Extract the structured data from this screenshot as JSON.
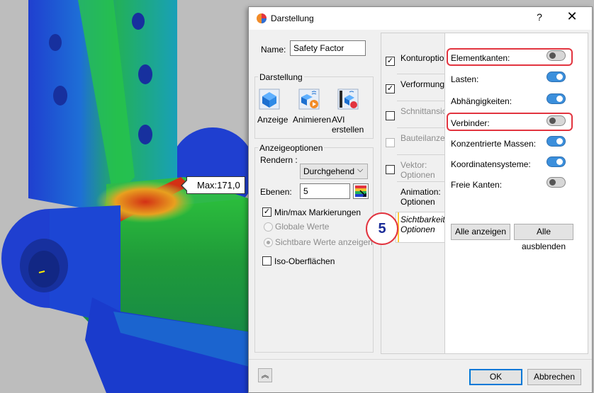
{
  "viewport": {
    "max_label": "Max:171,0",
    "colors": {
      "background": "#bdbdbd",
      "low": "#1f3fd0",
      "mid": "#22b05a",
      "high": "#d33015"
    }
  },
  "dialog": {
    "title": "Darstellung",
    "help_glyph": "?",
    "close_glyph": "✕",
    "name_label": "Name:",
    "name_value": "Safety Factor",
    "darstellung_group": "Darstellung",
    "actions": [
      {
        "label": "Anzeige",
        "icon": "cube-display-icon"
      },
      {
        "label": "Animieren",
        "icon": "animate-icon"
      },
      {
        "label": "AVI erstellen",
        "icon": "avi-record-icon"
      }
    ],
    "anzeige_group": "Anzeigeoptionen",
    "render_label": "Rendern :",
    "render_value": "Durchgehend",
    "levels_label": "Ebenen:",
    "levels_value": "5",
    "minmax_label": "Min/max Markierungen",
    "minmax_checked": true,
    "global_label": "Globale Werte",
    "visible_label": "Sichtbare Werte anzeigen",
    "iso_label": "Iso-Oberflächen",
    "iso_checked": false,
    "tabs": [
      {
        "label": "Konturoptionen",
        "checked": true
      },
      {
        "label": "Verformungsoptionen",
        "checked": true
      },
      {
        "label": "Schnittansicht",
        "checked": false
      },
      {
        "label": "Bauteilanzeige",
        "checked": false
      },
      {
        "label": "Vektor: Optionen",
        "checked": false
      },
      {
        "label": "Animation: Optionen"
      },
      {
        "label": "Sichtbarkeit: Optionen",
        "selected": true
      }
    ],
    "visibility": [
      {
        "label": "Elementkanten:",
        "on": false,
        "highlighted": true
      },
      {
        "label": "Lasten:",
        "on": true
      },
      {
        "label": "Abhängigkeiten:",
        "on": true
      },
      {
        "label": "Verbinder:",
        "on": false,
        "highlighted": true
      },
      {
        "label": "Konzentrierte Massen:",
        "on": true
      },
      {
        "label": "Koordinatensysteme:",
        "on": true
      },
      {
        "label": "Freie Kanten:",
        "on": false
      }
    ],
    "show_all": "Alle anzeigen",
    "hide_all": "Alle ausblenden",
    "ok": "OK",
    "cancel": "Abbrechen",
    "expand_glyph": "︽",
    "step_badge": "5",
    "accent_color": "#0078d7",
    "highlight_color": "#e2343f"
  }
}
